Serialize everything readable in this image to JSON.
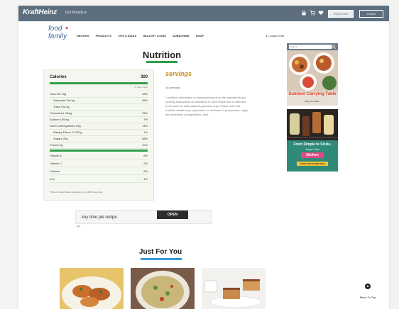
{
  "topbar": {
    "brand": "KraftHeinz",
    "brands_menu": "Our Brands ▾",
    "register_label": "REGISTER",
    "login_label": "LOGIN"
  },
  "logo": {
    "line1": "food",
    "line2": "family",
    "heart": "♥"
  },
  "nav": {
    "items": [
      "RECIPES",
      "PRODUCTS",
      "TIPS & IDEAS",
      "HEALTHY LIVING",
      "SUBSCRIBE",
      "SHOP"
    ],
    "signin": "Locate Kraft"
  },
  "nutrition": {
    "title": "Nutrition",
    "calories_label": "Calories",
    "calories_value": "300",
    "dv_header": "% Daily Value",
    "rows": [
      {
        "name": "Total Fat 13g",
        "pct": "18%"
      },
      {
        "name": "Saturated Fat 5g",
        "pct": "26%"
      },
      {
        "name": "Trans Fat 0g",
        "pct": ""
      },
      {
        "name": "Cholesterol 45mg",
        "pct": "15%"
      },
      {
        "name": "Sodium 150mg",
        "pct": "7%"
      },
      {
        "name": "Total Carbohydrates 39g",
        "pct": "14%"
      },
      {
        "name": "Dietary Fibers 0.3797g",
        "pct": "1%"
      },
      {
        "name": "Sugars 29g",
        "pct": "58%"
      },
      {
        "name": "Protein 5g",
        "pct": "10%"
      },
      {
        "name": "Vitamin A",
        "pct": "8%"
      },
      {
        "name": "Vitamin C",
        "pct": "2%"
      },
      {
        "name": "Calcium",
        "pct": "6%"
      },
      {
        "name": "Iron",
        "pct": "4%"
      }
    ],
    "footnote": "* Percent Daily Values are based on a 2,000 calorie diet."
  },
  "servings": {
    "title": "servings",
    "count": "16 servings",
    "note": "* Nutrition information is estimated based on the ingredients and cooking instructions as described in each recipe and is intended to be used for informational purposes only. Please note that nutrition details may vary based on methods of preparation, origin and freshness of ingredients used."
  },
  "ad1": {
    "search_placeholder": "Search",
    "title": "Summer Carrying Table",
    "subtitle": "Shop the Table ›"
  },
  "ad2": {
    "headline": "From Simple to Sizzle,",
    "subline": "Super Fast",
    "brand": "kitchen",
    "cta": "SHOP TOGETHER NOW"
  },
  "search": {
    "value": "key lime pie recipe",
    "button_label": "OPEN",
    "caption": "ads"
  },
  "just_for_you": {
    "title": "Just For You"
  },
  "to_top": {
    "label": "Move To Top",
    "icon": "arrow-up-icon"
  },
  "colors": {
    "topbar": "#5d6f7e",
    "accent_green": "#2f9e4a",
    "accent_blue": "#3a9ad9",
    "servings_gold": "#c98b18"
  }
}
